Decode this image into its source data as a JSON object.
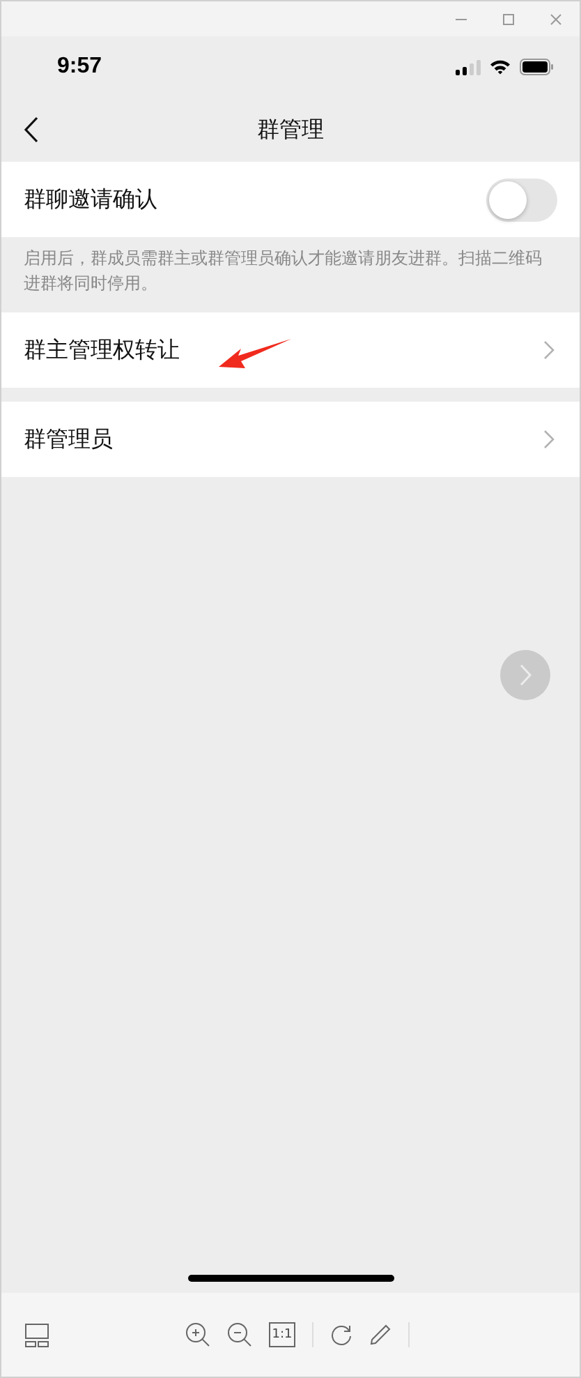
{
  "status_bar": {
    "time": "9:57"
  },
  "nav": {
    "title": "群管理"
  },
  "sections": [
    {
      "rows": [
        {
          "kind": "toggle",
          "label": "群聊邀请确认",
          "on": false
        }
      ],
      "note": "启用后，群成员需群主或群管理员确认才能邀请朋友进群。扫描二维码进群将同时停用。"
    },
    {
      "rows": [
        {
          "kind": "link",
          "label": "群主管理权转让",
          "annotated": true
        }
      ]
    },
    {
      "rows": [
        {
          "kind": "link",
          "label": "群管理员",
          "annotated": false
        }
      ]
    }
  ],
  "viewer_toolbar": {
    "actual_size_label": "1:1"
  }
}
